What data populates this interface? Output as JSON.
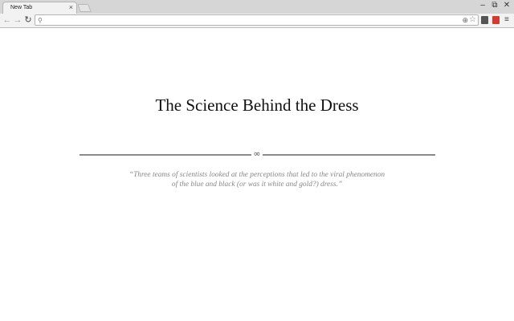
{
  "browser": {
    "tab": {
      "title": "New Tab",
      "close_glyph": "×"
    },
    "window_controls": {
      "minimize": "–",
      "restore": "⧉",
      "close": "✕"
    },
    "nav": {
      "back": "←",
      "forward": "→",
      "reload": "↻"
    },
    "omnibox": {
      "value": "",
      "placeholder": "",
      "search_glyph": "⚲",
      "zoom_glyph": "⊕",
      "star_glyph": "☆"
    },
    "extensions": [
      {
        "icon": "pocket-icon",
        "color": "#555555"
      },
      {
        "icon": "red-extension-icon",
        "color": "#d63a2f"
      }
    ],
    "menu_glyph": "≡"
  },
  "page": {
    "title": "The Science Behind the Dress",
    "divider_glyph": "∞",
    "quote_line1": "“Three teams of scientists looked at the perceptions that led to the viral phenomenon",
    "quote_line2": "of the blue and black (or was it white and gold?) dress.”"
  }
}
